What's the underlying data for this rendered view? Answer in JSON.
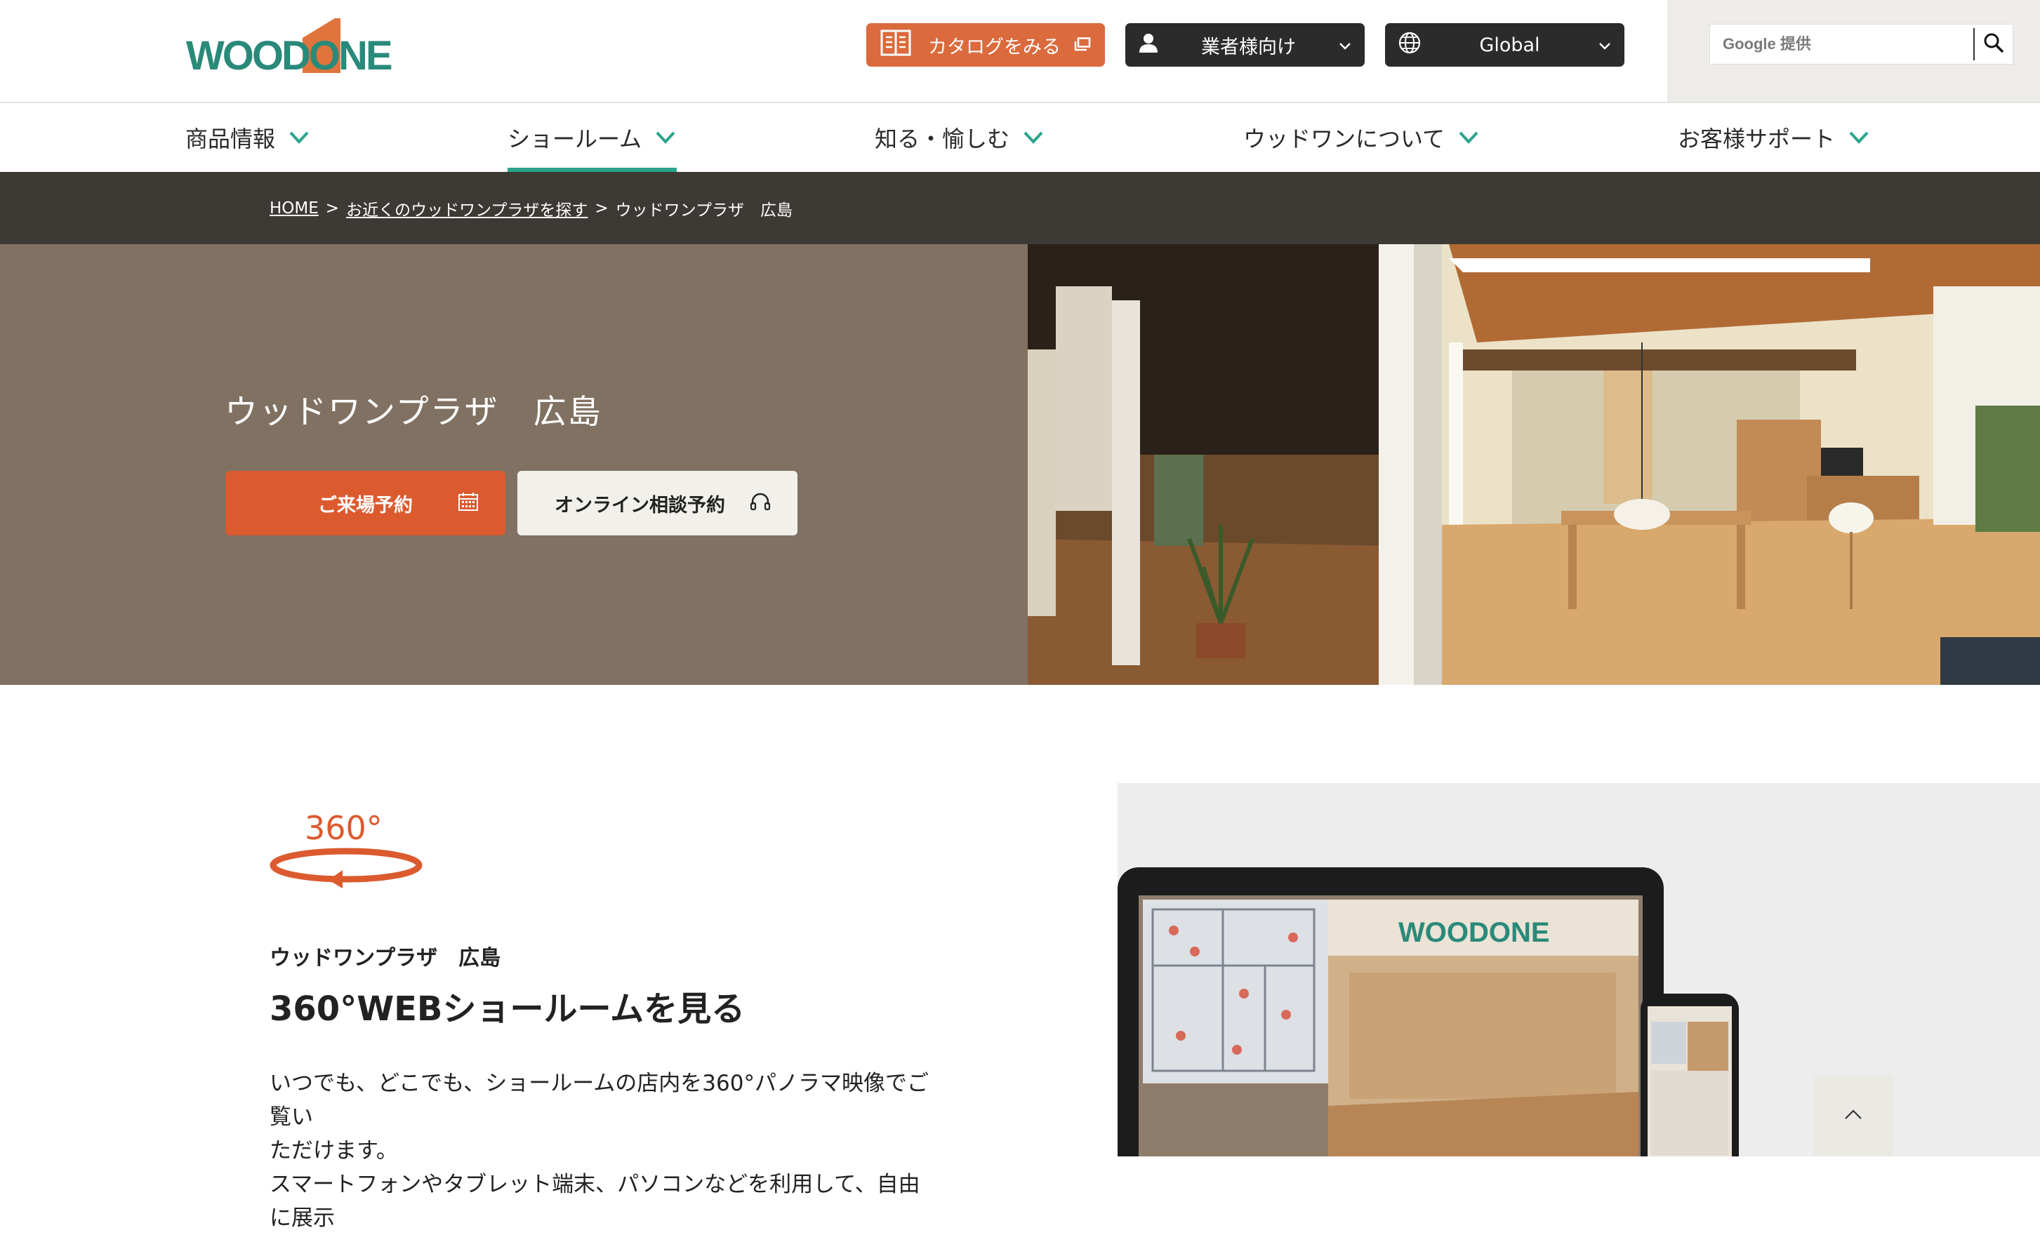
{
  "header": {
    "logo_text": "WOODONE",
    "catalog_label": "カタログをみる",
    "business_label": "業者様向け",
    "global_label": "Global",
    "search": {
      "placeholder": "Google 提供",
      "button_icon": "search-icon"
    }
  },
  "nav": {
    "items": [
      {
        "label": "商品情報"
      },
      {
        "label": "ショールーム"
      },
      {
        "label": "知る・愉しむ"
      },
      {
        "label": "ウッドワンについて"
      },
      {
        "label": "お客様サポート"
      }
    ],
    "active_index": 1
  },
  "breadcrumb": {
    "home": "HOME",
    "separator": ">",
    "parent": "お近くのウッドワンプラザを探す",
    "current": "ウッドワンプラザ　広島"
  },
  "hero": {
    "title": "ウッドワンプラザ　広島",
    "visit_label": "ご来場予約",
    "online_label": "オンライン相談予約"
  },
  "webshowroom": {
    "logo_text": "360°",
    "subtitle": "ウッドワンプラザ　広島",
    "title": "360°WEBショールームを見る",
    "description": [
      "いつでも、どこでも、ショールームの店内を360°パノラマ映像でご覧い",
      "ただけます。",
      "スマートフォンやタブレット端末、パソコンなどを利用して、自由に展示"
    ],
    "screen_logo": "WOODONE"
  },
  "colors": {
    "brand_green": "#2a8a7a",
    "brand_orange": "#db5b2f",
    "nav_active": "#2aa58c",
    "breadcrumb_bg": "#3d3a35",
    "hero_bg": "#807162"
  }
}
